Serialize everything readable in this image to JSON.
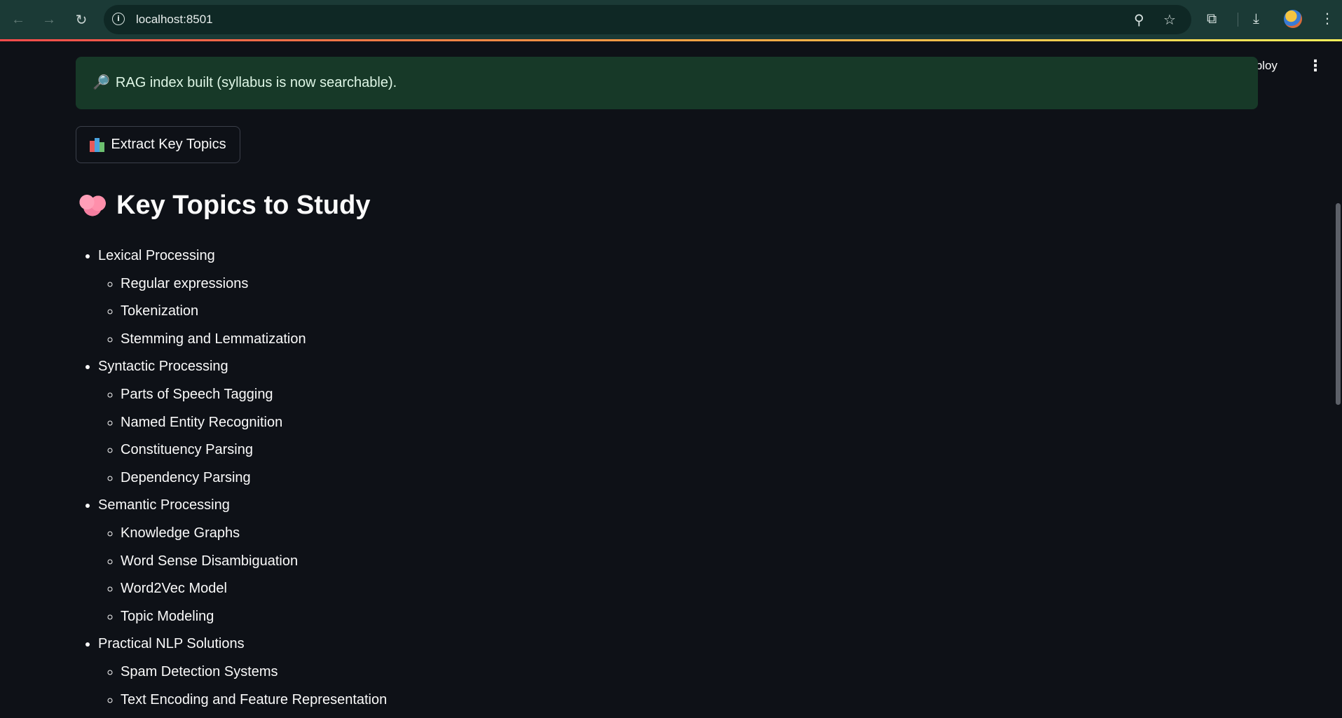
{
  "browser": {
    "url": "localhost:8501",
    "icons": {
      "back": "arrow-left-icon",
      "forward": "arrow-right-icon",
      "reload": "reload-icon",
      "info": "info-icon",
      "zoom": "zoom-icon",
      "bookmark": "star-icon",
      "extensions": "puzzle-icon",
      "downloads": "download-icon",
      "menu": "kebab-icon"
    }
  },
  "app_header": {
    "deploy_label": "Deploy"
  },
  "success_message": {
    "icon": "🔎",
    "text": "RAG index built (syllabus is now searchable)."
  },
  "extract_button": {
    "icon": "books-icon",
    "label": "Extract Key Topics"
  },
  "heading": {
    "icon": "brain-icon",
    "text": "Key Topics to Study"
  },
  "topics": [
    {
      "title": "Lexical Processing",
      "subtopics": [
        "Regular expressions",
        "Tokenization",
        "Stemming and Lemmatization"
      ]
    },
    {
      "title": "Syntactic Processing",
      "subtopics": [
        "Parts of Speech Tagging",
        "Named Entity Recognition",
        "Constituency Parsing",
        "Dependency Parsing"
      ]
    },
    {
      "title": "Semantic Processing",
      "subtopics": [
        "Knowledge Graphs",
        "Word Sense Disambiguation",
        "Word2Vec Model",
        "Topic Modeling"
      ]
    },
    {
      "title": "Practical NLP Solutions",
      "subtopics": [
        "Spam Detection Systems",
        "Text Encoding and Feature Representation"
      ]
    }
  ],
  "colors": {
    "background": "#0e1117",
    "success_bg": "#173928",
    "chrome_bg": "#1b3a36"
  }
}
